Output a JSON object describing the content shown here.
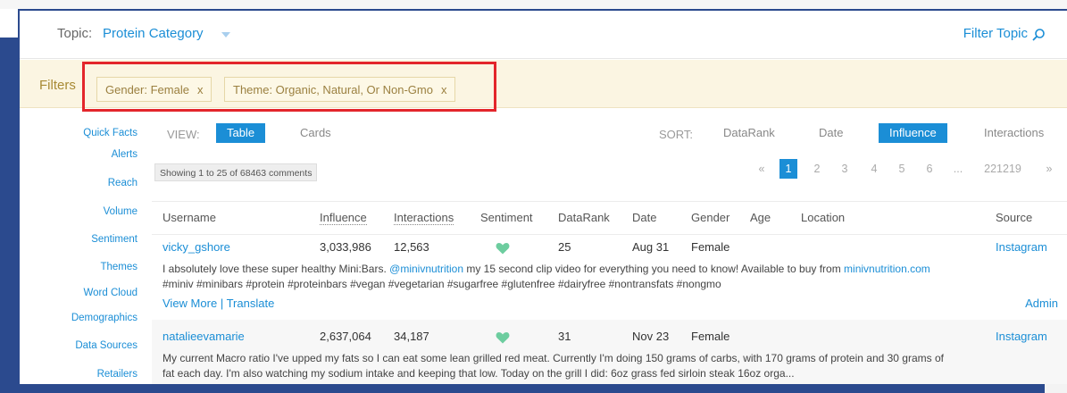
{
  "topic": {
    "label": "Topic:",
    "value": "Protein Category",
    "filter_link": "Filter Topic"
  },
  "filters": {
    "label": "Filters",
    "chips": [
      {
        "text": "Gender: Female",
        "remove": "x"
      },
      {
        "text": "Theme: Organic, Natural, Or Non-Gmo",
        "remove": "x"
      }
    ]
  },
  "sidebar": {
    "items": [
      "Quick Facts",
      "Alerts",
      "Reach",
      "Volume",
      "Sentiment",
      "Themes",
      "Word Cloud",
      "Demographics",
      "Data Sources",
      "Retailers"
    ]
  },
  "view": {
    "label": "VIEW:",
    "options": [
      "Table",
      "Cards"
    ],
    "selected": "Table"
  },
  "sort": {
    "label": "SORT:",
    "options": [
      "DataRank",
      "Date",
      "Influence",
      "Interactions"
    ],
    "selected": "Influence"
  },
  "showing": "Showing 1 to 25 of 68463 comments",
  "pagination": {
    "prev": "«",
    "pages": [
      "1",
      "2",
      "3",
      "4",
      "5",
      "6"
    ],
    "ellipsis": "...",
    "last": "221219",
    "next": "»",
    "current": "1"
  },
  "table": {
    "columns": [
      "Username",
      "Influence",
      "Interactions",
      "Sentiment",
      "DataRank",
      "Date",
      "Gender",
      "Age",
      "Location",
      "Source"
    ],
    "rows": [
      {
        "username": "vicky_gshore",
        "influence": "3,033,986",
        "interactions": "12,563",
        "sentiment": "heart-icon",
        "datarank": "25",
        "date": "Aug 31",
        "gender": "Female",
        "age": "",
        "location": "",
        "source": "Instagram",
        "comment_pre": "I absolutely love these super healthy Mini:Bars. ",
        "comment_mention": "@minivnutrition",
        "comment_mid": " my 15 second clip video for everything you need to know! Available to buy from ",
        "comment_link": "minivnutrition.com",
        "comment_tags": "#miniv #minibars #protein #proteinbars #vegan #vegetarian #sugarfree #glutenfree #dairyfree #nontransfats #nongmo",
        "view_more": "View More",
        "separator": "|",
        "translate": "Translate",
        "admin": "Admin"
      },
      {
        "username": "natalieevamarie",
        "influence": "2,637,064",
        "interactions": "34,187",
        "sentiment": "heart-icon",
        "datarank": "31",
        "date": "Nov 23",
        "gender": "Female",
        "age": "",
        "location": "",
        "source": "Instagram",
        "comment_line1": "My current Macro ratio I've upped my fats so I can eat some lean grilled red meat. Currently I'm doing 150 grams of carbs, with 170 grams of protein and 30 grams of",
        "comment_line2": "fat each day. I'm also watching my sodium intake and keeping that low. Today on the grill I did: 6oz grass fed sirloin steak 16oz orga..."
      }
    ]
  },
  "colors": {
    "accent": "#1b8ed6",
    "filter_bg": "#fbf5e2",
    "highlight": "#e3262b",
    "sentiment_positive": "#6dcd9f"
  }
}
